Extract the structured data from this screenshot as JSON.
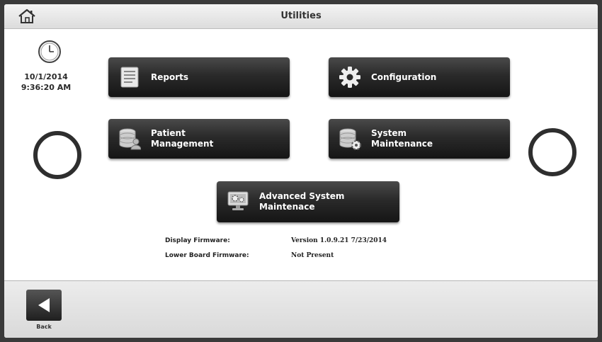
{
  "header": {
    "title": "Utilities",
    "home_icon": "home-icon"
  },
  "status": {
    "date": "10/1/2014",
    "time": "9:36:20 AM",
    "clock_icon": "clock-icon"
  },
  "menu": {
    "reports": {
      "label": "Reports",
      "icon": "report-document-icon"
    },
    "configuration": {
      "label": "Configuration",
      "icon": "gear-icon"
    },
    "patient_management": {
      "line1": "Patient",
      "line2": "Management",
      "icon": "database-user-icon"
    },
    "system_maintenance": {
      "line1": "System",
      "line2": "Maintenance",
      "icon": "database-gear-icon"
    },
    "advanced_system_maintenance": {
      "line1": "Advanced System",
      "line2": "Maintenace",
      "icon": "monitor-gear-icon"
    }
  },
  "firmware": {
    "display_label": "Display Firmware:",
    "display_value": "Version 1.0.9.21  7/23/2014",
    "lower_board_label": "Lower Board Firmware:",
    "lower_board_value": "Not Present"
  },
  "footer": {
    "back_label": "Back",
    "back_icon": "back-arrow-icon"
  },
  "colors": {
    "tile_dark": "#1f1f1f",
    "tile_light": "#4a4a4a",
    "ring": "#2e2e2e",
    "background": "#ffffff"
  }
}
